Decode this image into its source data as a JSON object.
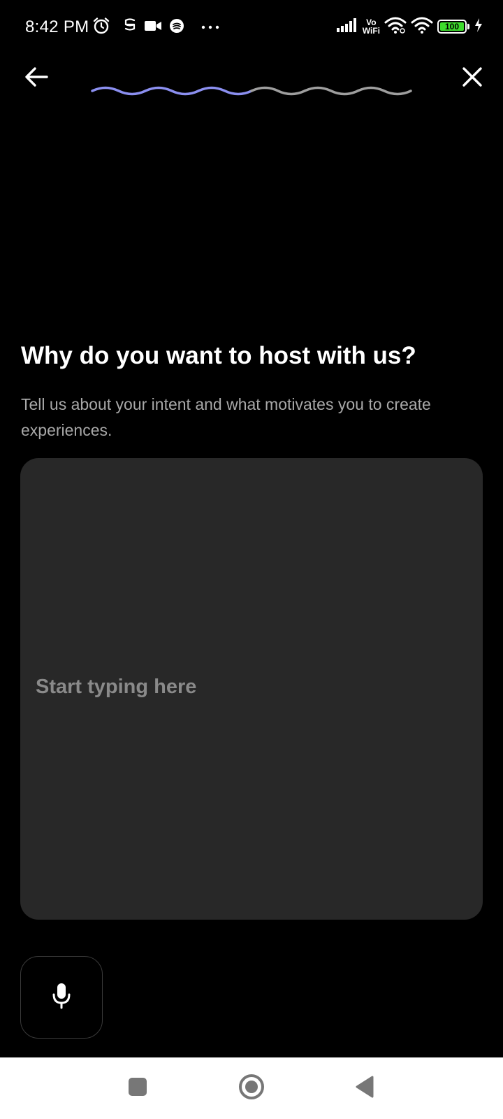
{
  "status_bar": {
    "time": "8:42 PM",
    "vowifi_top": "Vo",
    "vowifi_bottom": "WiFi",
    "battery_level": "100",
    "icons_left": [
      "alarm-icon",
      "notification-icon",
      "video-camera-icon",
      "app-icon",
      "more-dots-icon"
    ],
    "icons_right": [
      "signal-icon",
      "vowifi-icon",
      "wifi-icon",
      "wifi-icon",
      "battery-icon",
      "charging-icon"
    ]
  },
  "header": {
    "back_icon": "arrow-left-icon",
    "close_icon": "close-icon",
    "progress": {
      "total_steps": 6,
      "completed_steps": 3,
      "active_color": "#8b8ff0",
      "inactive_color": "#9e9e9e"
    }
  },
  "main": {
    "title": "Why do you want to host with us?",
    "subtitle": "Tell us about your intent and what motivates you to create experiences.",
    "input": {
      "value": "",
      "placeholder": "Start typing here"
    },
    "mic_icon": "microphone-icon"
  },
  "nav_bar": {
    "recents_icon": "square-icon",
    "home_icon": "circle-icon",
    "back_icon": "triangle-back-icon"
  },
  "colors": {
    "background": "#000000",
    "input_background": "#282828",
    "title": "#ffffff",
    "subtitle": "#a8a8a8",
    "placeholder": "#8a8a8a",
    "progress_active": "#8b8ff0",
    "progress_inactive": "#9e9e9e",
    "battery": "#3ddc2c"
  }
}
